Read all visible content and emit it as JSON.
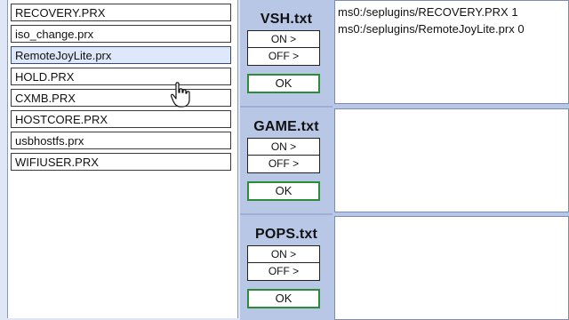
{
  "plugin_files": [
    "RECOVERY.PRX",
    "iso_change.prx",
    "RemoteJoyLite.prx",
    "HOLD.PRX",
    "CXMB.PRX",
    "HOSTCORE.PRX",
    "usbhostfs.prx",
    "WIFIUSER.PRX"
  ],
  "sections": [
    {
      "title": "VSH.txt",
      "on_label": "ON >",
      "off_label": "OFF >",
      "ok_label": "OK",
      "lines": [
        "ms0:/seplugins/RECOVERY.PRX 1",
        "ms0:/seplugins/RemoteJoyLite.prx 0"
      ]
    },
    {
      "title": "GAME.txt",
      "on_label": "ON >",
      "off_label": "OFF >",
      "ok_label": "OK",
      "lines": []
    },
    {
      "title": "POPS.txt",
      "on_label": "ON >",
      "off_label": "OFF >",
      "ok_label": "OK",
      "lines": []
    }
  ],
  "selected_file": "RemoteJoyLite.prx",
  "icons": {
    "cursor": "hand-pointer-icon"
  },
  "colors": {
    "ok_border": "#2e8b3a",
    "panel_bg": "#b9c7e6",
    "selected_bg": "#dde8fb"
  }
}
